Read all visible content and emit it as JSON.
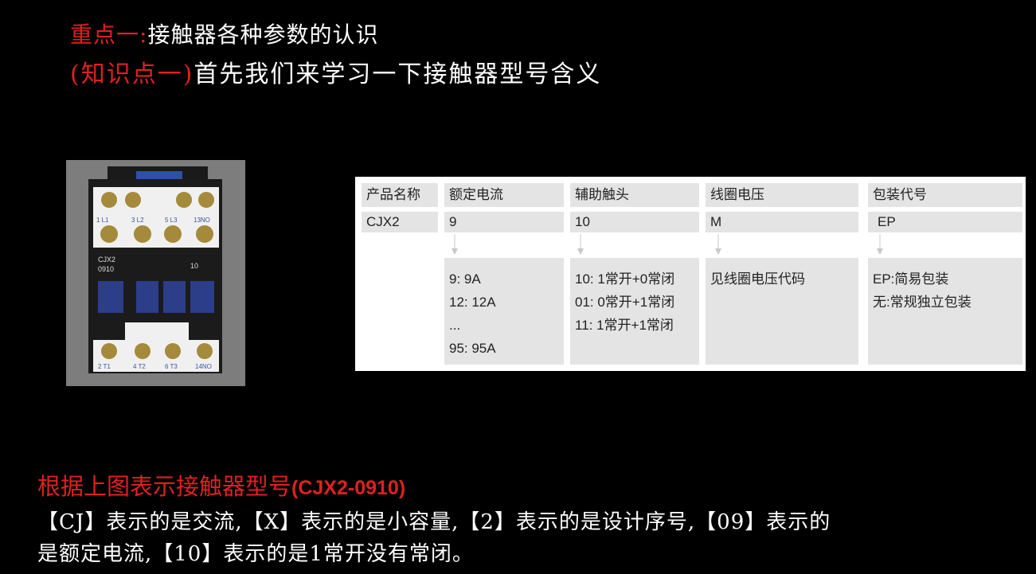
{
  "heading": {
    "line1_red": "重点一:",
    "line1_white": "接触器各种参数的认识",
    "line2_red": "(知识点一)",
    "line2_white": "首先我们来学习一下接触器型号含义"
  },
  "photo": {
    "model_label": "CJX2",
    "model_number": "0910",
    "aux_label": "10",
    "top_terminals": [
      "1 L1",
      "3 L2",
      "5 L3",
      "13NO"
    ],
    "bottom_terminals": [
      "2 T1",
      "4 T2",
      "6 T3",
      "14NO"
    ]
  },
  "model_table": {
    "headers": [
      "产品名称",
      "额定电流",
      "辅助触头",
      "线圈电压",
      "包装代号"
    ],
    "values": [
      "CJX2",
      "9",
      "10",
      "M",
      "EP"
    ],
    "current_desc": [
      "9: 9A",
      "12: 12A",
      "...",
      "95: 95A"
    ],
    "aux_desc": [
      "10: 1常开+0常闭",
      "01: 0常开+1常闭",
      "11: 1常开+1常闭"
    ],
    "coil_desc": [
      "见线圈电压代码"
    ],
    "package_desc": [
      "EP:简易包装",
      "无:常规独立包装"
    ]
  },
  "explanation": {
    "title": "根据上图表示接触器型号",
    "title_model": "(CJX2-0910)",
    "line1": "【CJ】表示的是交流,【X】表示的是小容量,【2】表示的是设计序号,【09】表示的",
    "line2": "是额定电流,【10】表示的是1常开没有常闭。"
  },
  "colors": {
    "background": "#000000",
    "accent_red": "#e02020",
    "cell_gray": "#e4e4e4"
  }
}
